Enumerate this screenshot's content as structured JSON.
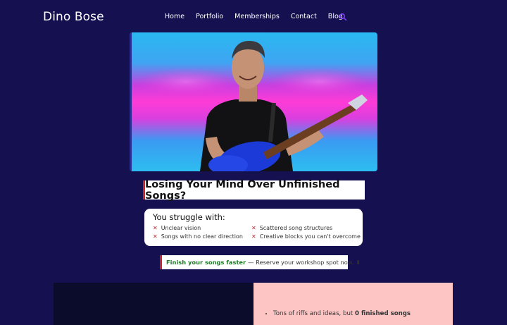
{
  "header": {
    "logo": "Dino Bose",
    "nav": [
      "Home",
      "Portfolio",
      "Memberships",
      "Contact",
      "Blog"
    ],
    "search_icon": "search-icon",
    "accent_color": "#7b3cf0"
  },
  "hero": {
    "image_alt": "Man in black t-shirt playing a blue electric guitar in front of a neon pink and blue background"
  },
  "headline": "Losing Your Mind Over Unfinished Songs?",
  "struggle": {
    "title": "You struggle with:",
    "items": [
      "Unclear vision",
      "Scattered song structures",
      "Songs with no clear direction",
      "Creative blocks you can't overcome"
    ],
    "bullet_icon": "x-icon",
    "bullet_color": "#c4262b"
  },
  "cta": {
    "strong": "Finish your songs faster",
    "text": "— Reserve your workshop spot now. ⬇"
  },
  "bottom": {
    "item_prefix": "Tons of riffs and ideas, but ",
    "item_bold": "0 finished songs"
  }
}
